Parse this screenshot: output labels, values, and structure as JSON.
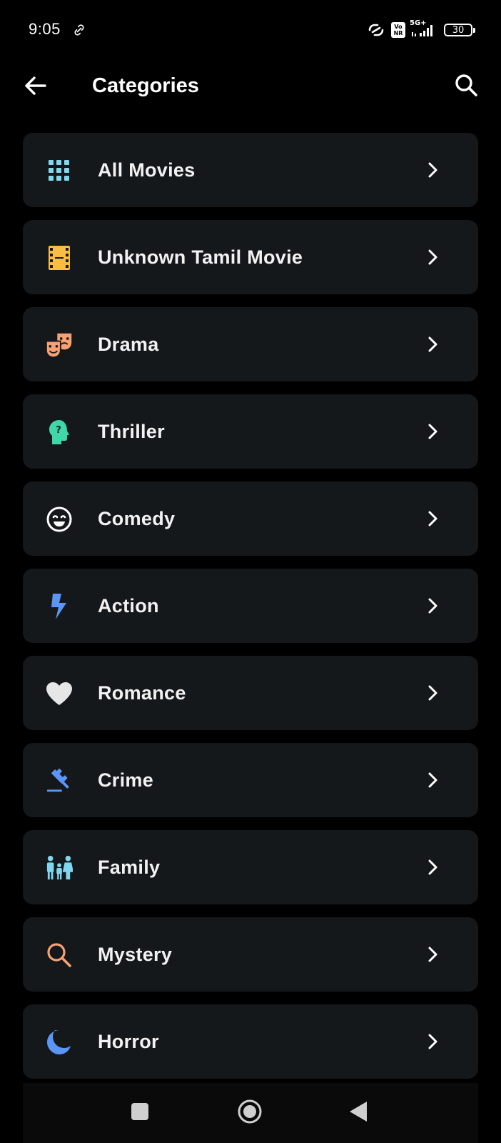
{
  "status_bar": {
    "time": "9:05",
    "network": "5G+",
    "volte": "Vo NR",
    "battery": "30"
  },
  "app_bar": {
    "title": "Categories",
    "back_icon": "arrow-left-icon",
    "search_icon": "search-icon"
  },
  "categories": [
    {
      "label": "All Movies",
      "icon": "grid-icon",
      "color": "#7fd8f0"
    },
    {
      "label": "Unknown Tamil Movie",
      "icon": "film-strip-icon",
      "color": "#f7bd45"
    },
    {
      "label": "Drama",
      "icon": "theater-masks-icon",
      "color": "#f5a173"
    },
    {
      "label": "Thriller",
      "icon": "head-question-icon",
      "color": "#3fd6a8"
    },
    {
      "label": "Comedy",
      "icon": "smiley-icon",
      "color": "#ffffff"
    },
    {
      "label": "Action",
      "icon": "lightning-icon",
      "color": "#5b95f5"
    },
    {
      "label": "Romance",
      "icon": "heart-icon",
      "color": "#e6e6e6"
    },
    {
      "label": "Crime",
      "icon": "gavel-icon",
      "color": "#5b95f5"
    },
    {
      "label": "Family",
      "icon": "family-icon",
      "color": "#7fd8f0"
    },
    {
      "label": "Mystery",
      "icon": "magnifier-icon",
      "color": "#f5a173"
    },
    {
      "label": "Horror",
      "icon": "moon-icon",
      "color": "#5b95f5"
    }
  ],
  "nav_bar": {
    "recents_icon": "square-icon",
    "home_icon": "circle-home-icon",
    "back_icon": "triangle-back-icon"
  },
  "colors": {
    "background": "#000000",
    "card": "#15181a",
    "text": "#f2f2f2"
  }
}
